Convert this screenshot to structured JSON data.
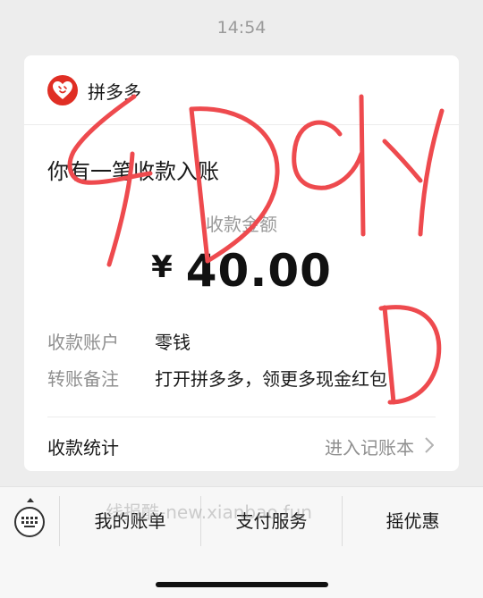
{
  "status_bar": {
    "time": "14:54"
  },
  "card": {
    "app_name": "拼多多",
    "notice_title": "你有一笔收款入账",
    "amount_label": "收款金额",
    "currency_symbol": "¥",
    "amount": "40.00",
    "details": [
      {
        "key": "收款账户",
        "value": "零钱"
      },
      {
        "key": "转账备注",
        "value": "打开拼多多，领更多现金红包"
      }
    ],
    "stats_label": "收款统计",
    "stats_link": "进入记账本"
  },
  "overlay": {
    "handwriting": "SDGYD",
    "color": "#ee4a4e"
  },
  "bottom_bar": {
    "watermark": "线报酷-new.xianbao.fun",
    "menu": [
      "我的账单",
      "支付服务",
      "摇优惠"
    ]
  },
  "colors": {
    "background": "#ededed",
    "brand": "#e02e24",
    "muted_text": "#8f8f8f"
  }
}
